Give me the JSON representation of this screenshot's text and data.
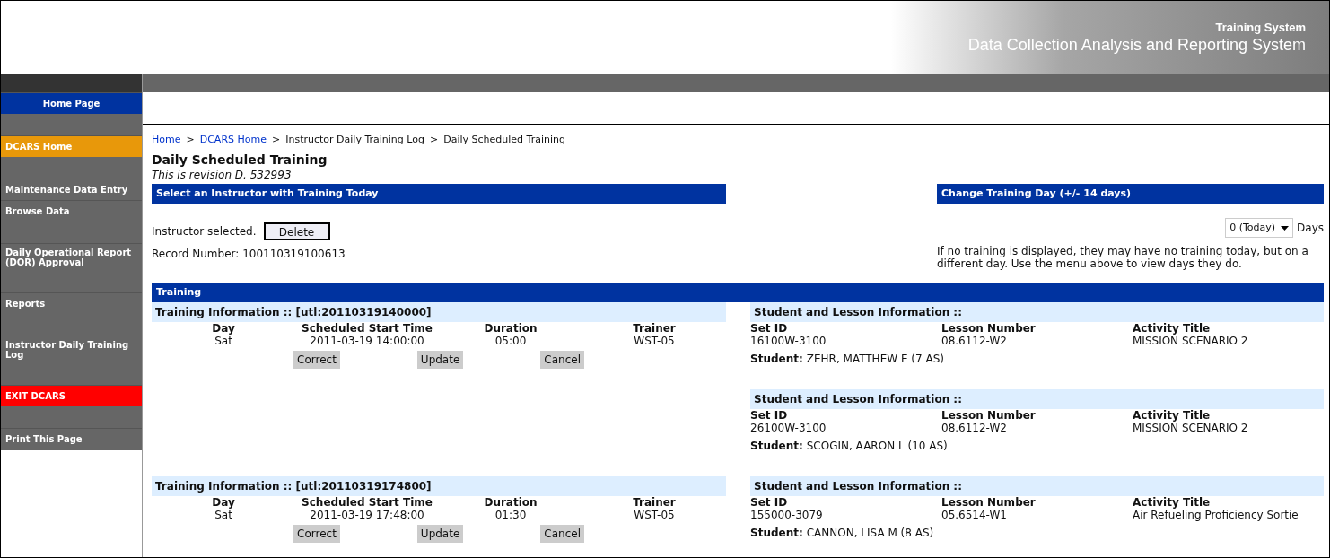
{
  "header": {
    "system": "Training System",
    "title": "Data Collection Analysis and Reporting System"
  },
  "sidebar": {
    "items": [
      {
        "label": "Home Page",
        "color": "#0033a0",
        "gap_before": false
      },
      {
        "label": "DCARS Home",
        "color": "#e8980a",
        "gap_before": true
      },
      {
        "label": "Maintenance Data Entry",
        "color": "#666666",
        "gap_before": true
      },
      {
        "label": "Browse Data",
        "color": "#666666",
        "gap_before": false
      },
      {
        "label": "Daily Operational Report (DOR) Approval",
        "color": "#666666",
        "gap_before": true
      },
      {
        "label": "Reports",
        "color": "#666666",
        "gap_before": true
      },
      {
        "label": "Instructor Daily Training Log",
        "color": "#666666",
        "gap_before": true
      },
      {
        "label": "EXIT DCARS",
        "color": "#ff0000",
        "gap_before": true
      },
      {
        "label": "Print This Page",
        "color": "#666666",
        "gap_before": true
      }
    ]
  },
  "breadcrumb": [
    {
      "label": "Home",
      "link": true
    },
    {
      "label": "DCARS Home",
      "link": true
    },
    {
      "label": "Instructor Daily Training Log",
      "link": false
    },
    {
      "label": "Daily Scheduled Training",
      "link": false
    }
  ],
  "breadcrumb_separator": ">",
  "page_title": "Daily Scheduled Training",
  "revision": "This is revision D. 532993",
  "instructor_panel": {
    "heading": "Select an Instructor with Training Today",
    "status": "Instructor selected.",
    "button": "Delete",
    "record": "Record Number: 100110319100613"
  },
  "day_panel": {
    "heading": "Change Training Day (+/- 14 days)",
    "select_value": "0 (Today)",
    "unit": "Days",
    "note": "If no training is displayed, they may have no training today, but on a different day. Use the menu above to view days they do."
  },
  "training": {
    "heading": "Training",
    "sessions": [
      {
        "title": "Training Information :: [utl:20110319140000]",
        "columns": [
          "Day",
          "Scheduled Start Time",
          "Duration",
          "Trainer"
        ],
        "values": [
          "Sat",
          "2011-03-19 14:00:00",
          "05:00",
          "WST-05"
        ],
        "buttons": [
          "Correct",
          "Update",
          "Cancel"
        ],
        "students": [
          {
            "title": "Student and Lesson Information ::",
            "columns": [
              "Set ID",
              "Lesson Number",
              "Activity Title"
            ],
            "values": [
              "16100W-3100",
              "08.6112-W2",
              "MISSION SCENARIO 2"
            ],
            "student_label": "Student:",
            "student": "ZEHR, MATTHEW E (7 AS)"
          },
          {
            "title": "Student and Lesson Information ::",
            "columns": [
              "Set ID",
              "Lesson Number",
              "Activity Title"
            ],
            "values": [
              "26100W-3100",
              "08.6112-W2",
              "MISSION SCENARIO 2"
            ],
            "student_label": "Student:",
            "student": "SCOGIN, AARON L (10 AS)"
          }
        ]
      },
      {
        "title": "Training Information :: [utl:20110319174800]",
        "columns": [
          "Day",
          "Scheduled Start Time",
          "Duration",
          "Trainer"
        ],
        "values": [
          "Sat",
          "2011-03-19 17:48:00",
          "01:30",
          "WST-05"
        ],
        "buttons": [
          "Correct",
          "Update",
          "Cancel"
        ],
        "students": [
          {
            "title": "Student and Lesson Information ::",
            "columns": [
              "Set ID",
              "Lesson Number",
              "Activity Title"
            ],
            "values": [
              "155000-3079",
              "05.6514-W1",
              "Air Refueling Proficiency Sortie"
            ],
            "student_label": "Student:",
            "student": "CANNON, LISA M (8 AS)"
          }
        ]
      }
    ]
  }
}
